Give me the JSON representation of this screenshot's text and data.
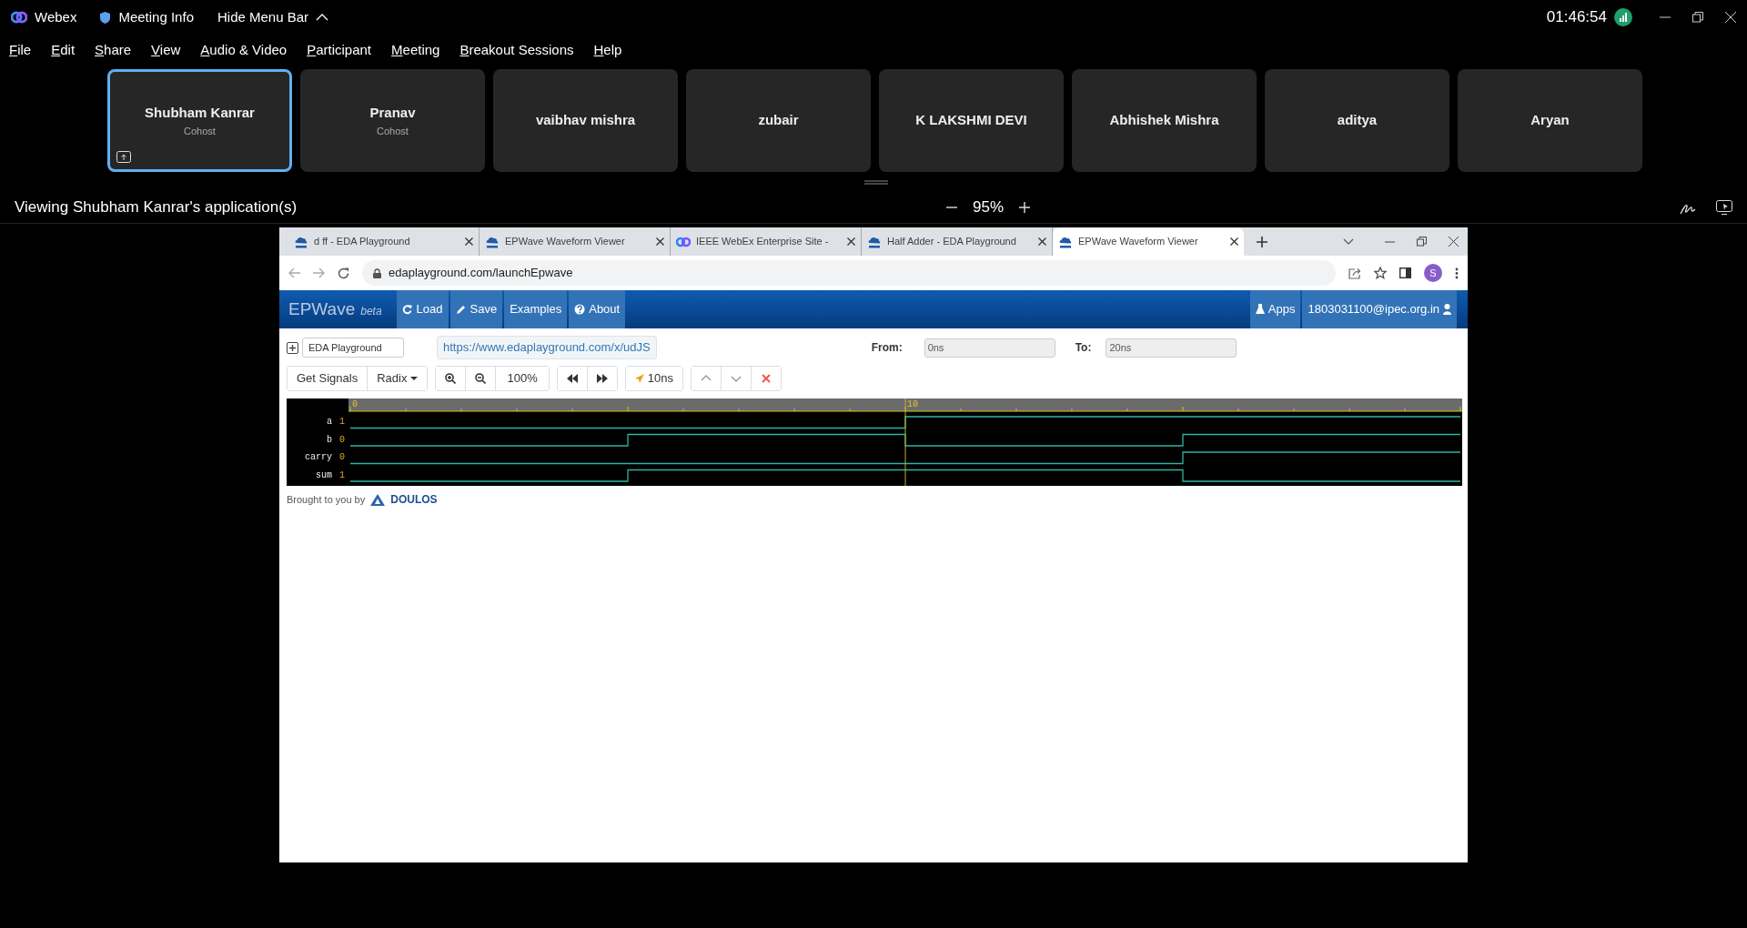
{
  "titlebar": {
    "app_name": "Webex",
    "meeting_info": "Meeting Info",
    "hide_menu_bar": "Hide Menu Bar",
    "clock": "01:46:54"
  },
  "menu": [
    "File",
    "Edit",
    "Share",
    "View",
    "Audio & Video",
    "Participant",
    "Meeting",
    "Breakout Sessions",
    "Help"
  ],
  "participants": [
    {
      "name": "Shubham Kanrar",
      "role": "Cohost",
      "selected": true,
      "sharing": true
    },
    {
      "name": "Pranav",
      "role": "Cohost",
      "selected": false,
      "sharing": false
    },
    {
      "name": "vaibhav mishra",
      "selected": false,
      "sharing": false
    },
    {
      "name": "zubair",
      "selected": false,
      "sharing": false
    },
    {
      "name": "K LAKSHMI DEVI",
      "selected": false,
      "sharing": false
    },
    {
      "name": "Abhishek Mishra",
      "selected": false,
      "sharing": false
    },
    {
      "name": "aditya",
      "selected": false,
      "sharing": false
    },
    {
      "name": "Aryan",
      "selected": false,
      "sharing": false
    }
  ],
  "share_bar": {
    "title": "Viewing Shubham Kanrar's application(s)",
    "zoom": "95%"
  },
  "browser": {
    "tabs": [
      {
        "title": "d ff - EDA Playground",
        "kind": "eda",
        "selected": false
      },
      {
        "title": "EPWave Waveform Viewer",
        "kind": "eda",
        "selected": false
      },
      {
        "title": "IEEE WebEx Enterprise Site - ",
        "kind": "webex",
        "selected": false
      },
      {
        "title": "Half Adder - EDA Playground",
        "kind": "eda",
        "selected": false
      },
      {
        "title": "EPWave Waveform Viewer",
        "kind": "eda",
        "selected": true
      }
    ],
    "url": "edaplayground.com/launchEpwave",
    "profile_initial": "S"
  },
  "epwave": {
    "brand": "EPWave",
    "brand_suffix": "beta",
    "nav": [
      "Load",
      "Save",
      "Examples",
      "About"
    ],
    "right_nav": [
      "Apps",
      "1803031100@ipec.org.in"
    ],
    "source_select": "EDA Playground",
    "link": "https://www.edaplayground.com/x/udJS",
    "from_label": "From:",
    "from": "0ns",
    "to_label": "To:",
    "to": "20ns",
    "toolbar": {
      "get_signals": "Get Signals",
      "radix": "Radix",
      "zoom": "100%",
      "cursor_time": "10ns"
    },
    "ruler_labels": [
      "0",
      "10"
    ],
    "signals": [
      {
        "name": "a",
        "value": "1"
      },
      {
        "name": "b",
        "value": "0"
      },
      {
        "name": "carry",
        "value": "0"
      },
      {
        "name": "sum",
        "value": "1"
      }
    ],
    "credit": "Brought to you by",
    "credit_logo": "DOULOS"
  }
}
